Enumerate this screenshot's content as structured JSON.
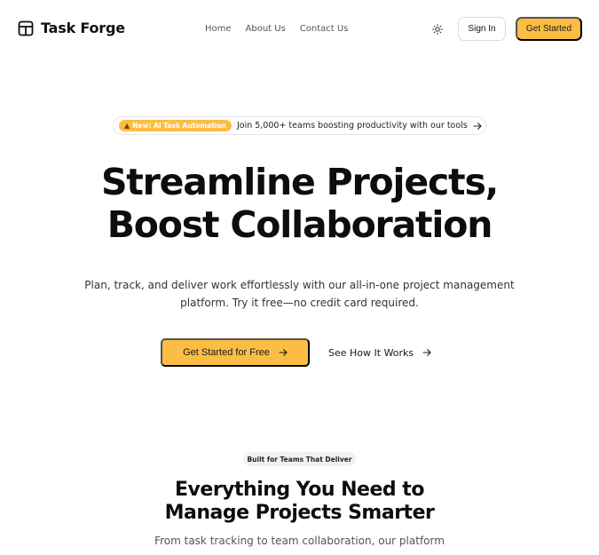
{
  "brand": {
    "name": "Task Forge",
    "icon": "layout-grid-icon"
  },
  "nav": {
    "items": [
      "Home",
      "About Us",
      "Contact Us"
    ]
  },
  "header": {
    "theme_icon": "sun-icon",
    "signin_label": "Sign In",
    "get_started_label": "Get Started"
  },
  "announcement": {
    "badge": "New: AI Task Automation",
    "badge_icon": "rocket-icon",
    "text": "Join 5,000+ teams boosting productivity with our tools",
    "arrow_icon": "arrow-right-icon"
  },
  "hero": {
    "title_line1": "Streamline Projects,",
    "title_line2": "Boost Collaboration",
    "subtitle_line1": "Plan, track, and deliver work effortlessly with our all-in-one project management",
    "subtitle_line2": "platform. Try it free—no credit card required.",
    "cta_primary": "Get Started for Free",
    "cta_secondary": "See How It Works"
  },
  "features": {
    "badge": "Built for Teams That Deliver",
    "title_line1": "Everything You Need to",
    "title_line2": "Manage Projects Smarter",
    "subtitle": "From task tracking to team collaboration, our platform"
  },
  "colors": {
    "accent": "#fbbd44",
    "text": "#111111",
    "muted": "#555555"
  }
}
